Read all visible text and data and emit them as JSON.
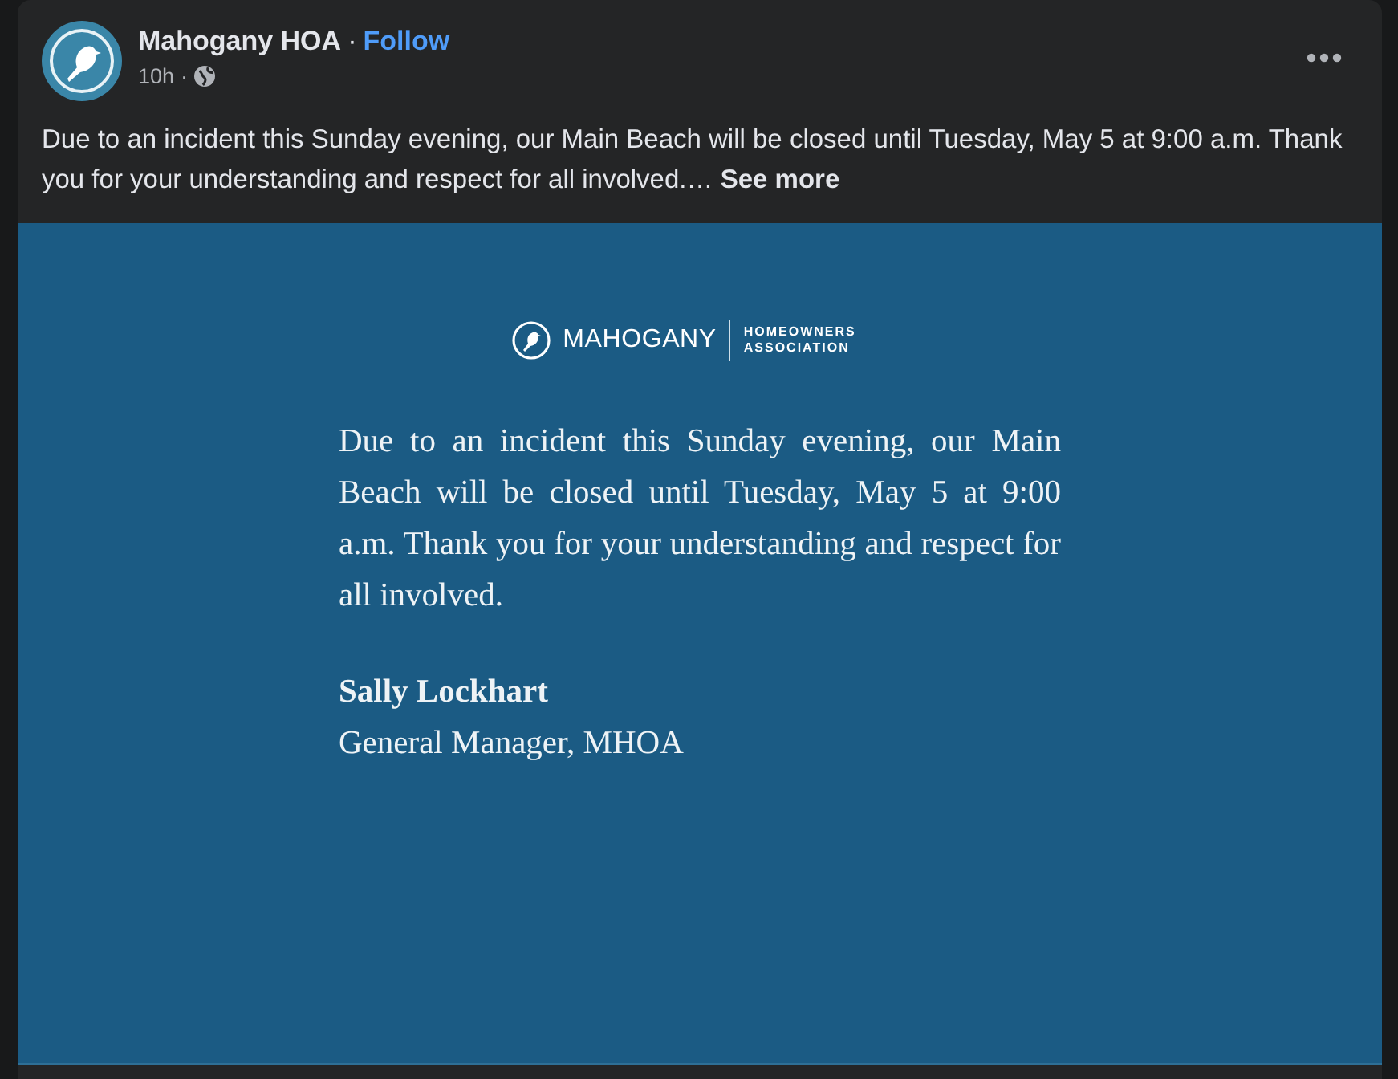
{
  "post": {
    "author": "Mahogany HOA",
    "separator": "·",
    "follow": "Follow",
    "time": "10h",
    "time_separator": "·",
    "text": "Due to an incident this Sunday evening, our Main Beach will be closed until Tuesday, May 5 at 9:00 a.m. Thank you for your understanding and respect for all involved.…",
    "see_more": "See more"
  },
  "image": {
    "brand": "MAHOGANY",
    "brand_sub_1": "HOMEOWNERS",
    "brand_sub_2": "ASSOCIATION",
    "message": "Due to an incident this Sunday evening, our Main Beach will be closed until Tuesday, May 5 at 9:00 a.m. Thank you for your understanding and respect for all involved.",
    "signer": "Sally Lockhart",
    "signer_title": "General Manager, MHOA"
  }
}
